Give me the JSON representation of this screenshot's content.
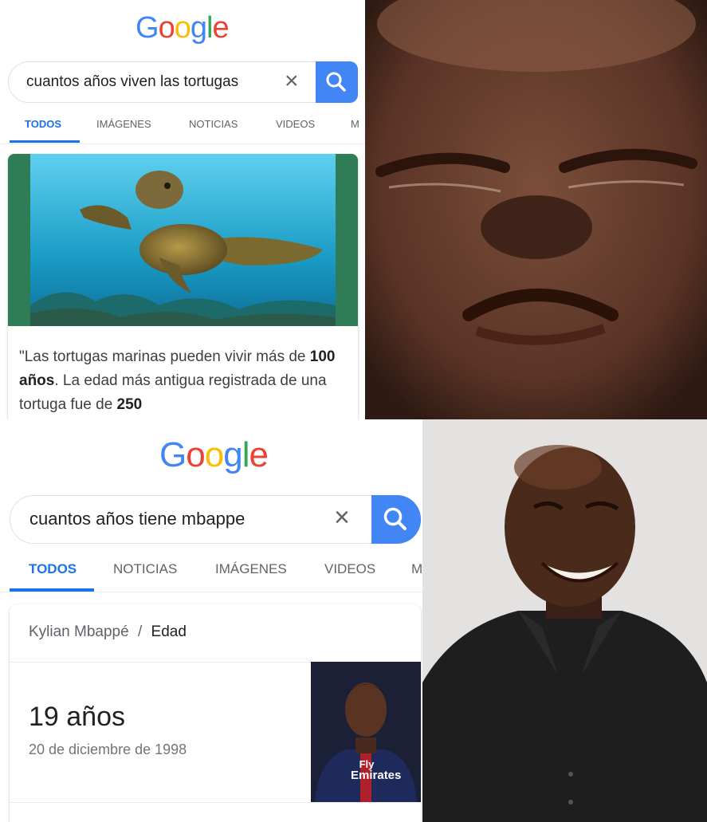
{
  "top": {
    "logo": [
      "G",
      "o",
      "o",
      "g",
      "l",
      "e"
    ],
    "query": "cuantos años viven las tortugas",
    "tabs": [
      "TODOS",
      "IMÁGENES",
      "NOTICIAS",
      "VIDEOS",
      "M"
    ],
    "quote_parts": {
      "p1": "\"Las tortugas marinas pueden vivir más de ",
      "b1": "100 años",
      "p2": ". La edad más antigua registrada de una tortuga fue de ",
      "b2": "250"
    }
  },
  "bottom": {
    "logo": [
      "G",
      "o",
      "o",
      "g",
      "l",
      "e"
    ],
    "query": "cuantos años tiene mbappe",
    "tabs": [
      "TODOS",
      "NOTICIAS",
      "IMÁGENES",
      "VIDEOS",
      "M"
    ],
    "breadcrumb": {
      "entity": "Kylian Mbappé",
      "sep": "/",
      "attr": "Edad"
    },
    "age": "19 años",
    "birthdate": "20 de diciembre de 1998",
    "jersey_text": [
      "Fly",
      "Emirates"
    ]
  },
  "icons": {
    "clear": "×",
    "search": "search-icon"
  },
  "colors": {
    "google_blue": "#4285F4",
    "tab_active": "#1a73e8",
    "ocean": "#1fa0c8",
    "panel_green": "#2e7d57"
  }
}
